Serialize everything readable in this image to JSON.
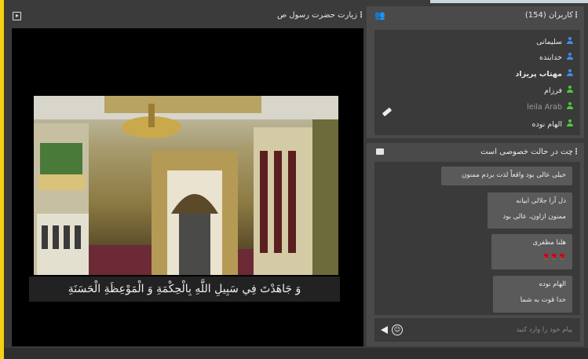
{
  "video": {
    "title": "زیارت حضرت رسول ص",
    "menu": "⋮",
    "caption": "وَ جَاهَدْتَ فِي سَبِيلِ اللَّهِ بِالْحِكْمَةِ وَ الْمَوْعِظَةِ الْحَسَنَةِ"
  },
  "users": {
    "title": "کاربران (154)",
    "menu": "⋮",
    "items": [
      {
        "name": "سلیمانی",
        "color": "#3f8be8"
      },
      {
        "name": "خدابنده",
        "color": "#3f8be8"
      },
      {
        "name": "مهتاب پریزاد",
        "color": "#3f8be8",
        "bold": true
      },
      {
        "name": "فرزام",
        "color": "#4fc83c"
      },
      {
        "name": "leila Arab",
        "color": "#4fc83c",
        "faded": true
      },
      {
        "name": "الهام نوده",
        "color": "#4fc83c"
      }
    ]
  },
  "chat": {
    "title": "چت در حالت خصوصی است",
    "menu": "⋮",
    "messages": [
      {
        "sender": "",
        "text": "خیلی عالی بود واقعاً لذت بردم ممنون"
      },
      {
        "sender": "دل آرا جلالی ابیانه",
        "text": "ممنون ازاون، عالی بود"
      },
      {
        "sender": "هلنا مظفری",
        "text": "🌹🌹🌹"
      },
      {
        "sender": "الهام نوده",
        "text": "خدا قوت به شما"
      }
    ],
    "placeholder": "پیام خود را وارد کنید"
  }
}
